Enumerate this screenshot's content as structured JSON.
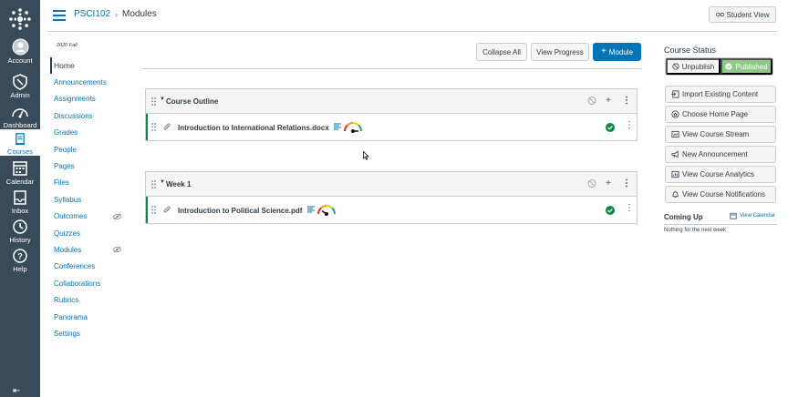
{
  "global_nav": {
    "items": [
      {
        "label": "Account",
        "icon": "account-icon"
      },
      {
        "label": "Admin",
        "icon": "admin-icon"
      },
      {
        "label": "Dashboard",
        "icon": "dashboard-icon"
      },
      {
        "label": "Courses",
        "icon": "courses-icon",
        "active": true
      },
      {
        "label": "Calendar",
        "icon": "calendar-icon"
      },
      {
        "label": "Inbox",
        "icon": "inbox-icon"
      },
      {
        "label": "History",
        "icon": "history-icon"
      },
      {
        "label": "Help",
        "icon": "help-icon"
      }
    ]
  },
  "header": {
    "course": "PSCI102",
    "separator": "›",
    "page": "Modules",
    "student_view": "Student View"
  },
  "course_nav": {
    "term": "2020 Fall",
    "items": [
      {
        "label": "Home",
        "active": true
      },
      {
        "label": "Announcements"
      },
      {
        "label": "Assignments"
      },
      {
        "label": "Discussions"
      },
      {
        "label": "Grades"
      },
      {
        "label": "People"
      },
      {
        "label": "Pages"
      },
      {
        "label": "Files"
      },
      {
        "label": "Syllabus"
      },
      {
        "label": "Outcomes",
        "hidden": true
      },
      {
        "label": "Quizzes"
      },
      {
        "label": "Modules",
        "hidden": true
      },
      {
        "label": "Conferences"
      },
      {
        "label": "Collaborations"
      },
      {
        "label": "Rubrics"
      },
      {
        "label": "Panorama"
      },
      {
        "label": "Settings"
      }
    ]
  },
  "toolbar": {
    "collapse_all": "Collapse All",
    "view_progress": "View Progress",
    "add_module": "Module"
  },
  "modules": [
    {
      "title": "Course Outline",
      "items": [
        {
          "title": "Introduction to International Relations.docx",
          "published": true
        }
      ]
    },
    {
      "title": "Week 1",
      "items": [
        {
          "title": "Introduction to Political Science.pdf",
          "published": true
        }
      ]
    }
  ],
  "sidebar": {
    "status_title": "Course Status",
    "unpublish": "Unpublish",
    "published": "Published",
    "buttons": [
      {
        "label": "Import Existing Content",
        "icon": "import-icon"
      },
      {
        "label": "Choose Home Page",
        "icon": "home-page-icon"
      },
      {
        "label": "View Course Stream",
        "icon": "stream-icon"
      },
      {
        "label": "New Announcement",
        "icon": "announcement-icon"
      },
      {
        "label": "View Course Analytics",
        "icon": "analytics-icon"
      },
      {
        "label": "View Course Notifications",
        "icon": "bell-icon"
      }
    ],
    "coming_up": "Coming Up",
    "view_calendar": "View Calendar",
    "nothing": "Nothing for the next week"
  },
  "colors": {
    "nav_bg": "#394b58",
    "link": "#0374b5",
    "published_green": "#90c78a",
    "success": "#0b874b"
  }
}
